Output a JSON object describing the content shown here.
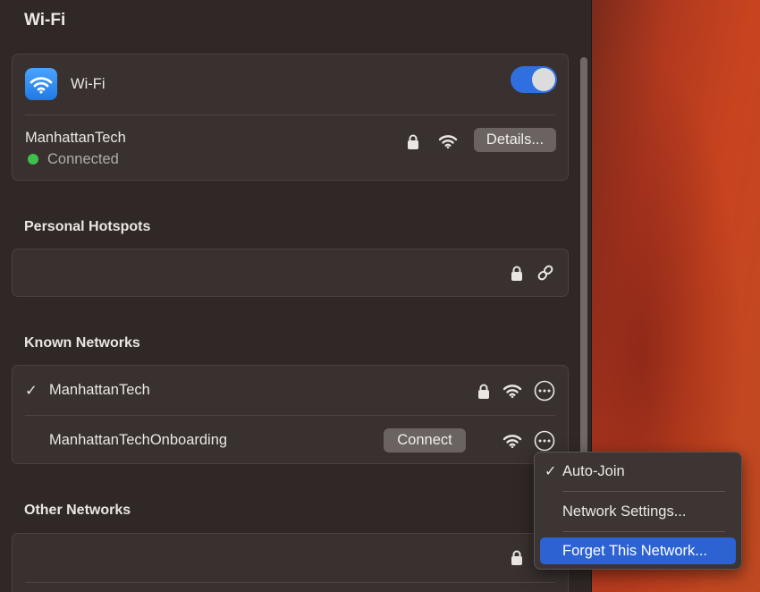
{
  "page": {
    "title": "Wi-Fi"
  },
  "wifi": {
    "label": "Wi-Fi",
    "enabled": true,
    "current_network": {
      "name": "ManhattanTech",
      "status": "Connected",
      "details_label": "Details..."
    }
  },
  "sections": {
    "personal_hotspots": "Personal Hotspots",
    "known_networks": "Known Networks",
    "other_networks": "Other Networks"
  },
  "known_networks": [
    {
      "name": "ManhattanTech",
      "checked": true,
      "check_glyph": "✓"
    },
    {
      "name": "ManhattanTechOnboarding",
      "connect_label": "Connect"
    }
  ],
  "context_menu": {
    "items": [
      {
        "label": "Auto-Join",
        "checked": true,
        "check_glyph": "✓"
      },
      {
        "label": "Network Settings..."
      },
      {
        "label": "Forget This Network...",
        "highlighted": true
      }
    ]
  },
  "icons": {
    "app": "wifi-icon",
    "lock": "lock-icon",
    "signal": "wifi-signal-icon",
    "more": "more-options-icon",
    "link": "link-icon"
  },
  "colors": {
    "accent": "#2f6fe0",
    "connected_dot": "#3ec14b",
    "menu_highlight": "#2c62d2"
  }
}
